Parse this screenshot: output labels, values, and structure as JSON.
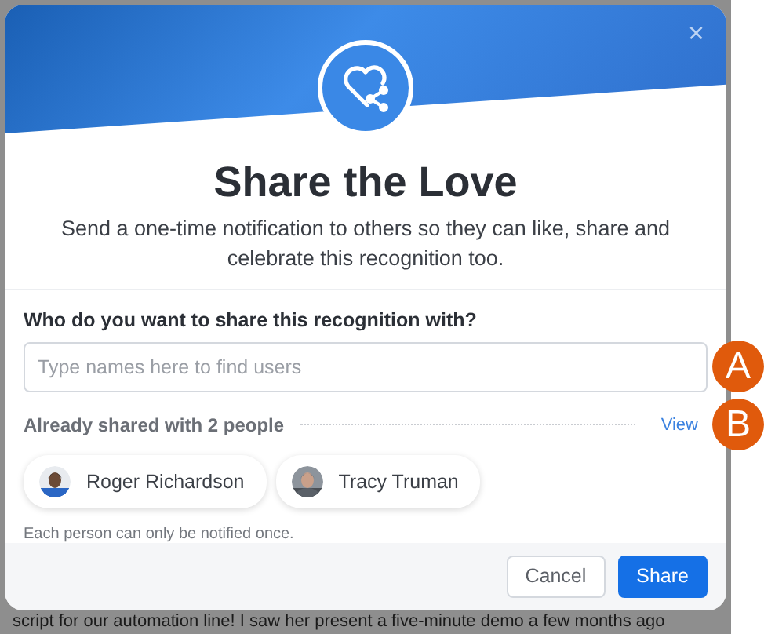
{
  "background_text": "script for our automation line! I saw her present a five-minute demo a few months ago",
  "dialog": {
    "close": "×",
    "title": "Share the Love",
    "subtitle": "Send a one-time notification to others so they can like, share and celebrate this recognition too.",
    "question": "Who do you want to share this recognition with?",
    "search": {
      "placeholder": "Type names here to find users"
    },
    "shared": {
      "label": "Already shared with 2 people",
      "link": "View"
    },
    "people": [
      {
        "name": "Roger Richardson"
      },
      {
        "name": "Tracy Truman"
      }
    ],
    "note": "Each person can only be notified once.",
    "buttons": [
      {
        "label": "Cancel",
        "kind": "secondary"
      },
      {
        "label": "Share",
        "kind": "primary"
      }
    ]
  },
  "callouts": [
    "A",
    "B"
  ]
}
